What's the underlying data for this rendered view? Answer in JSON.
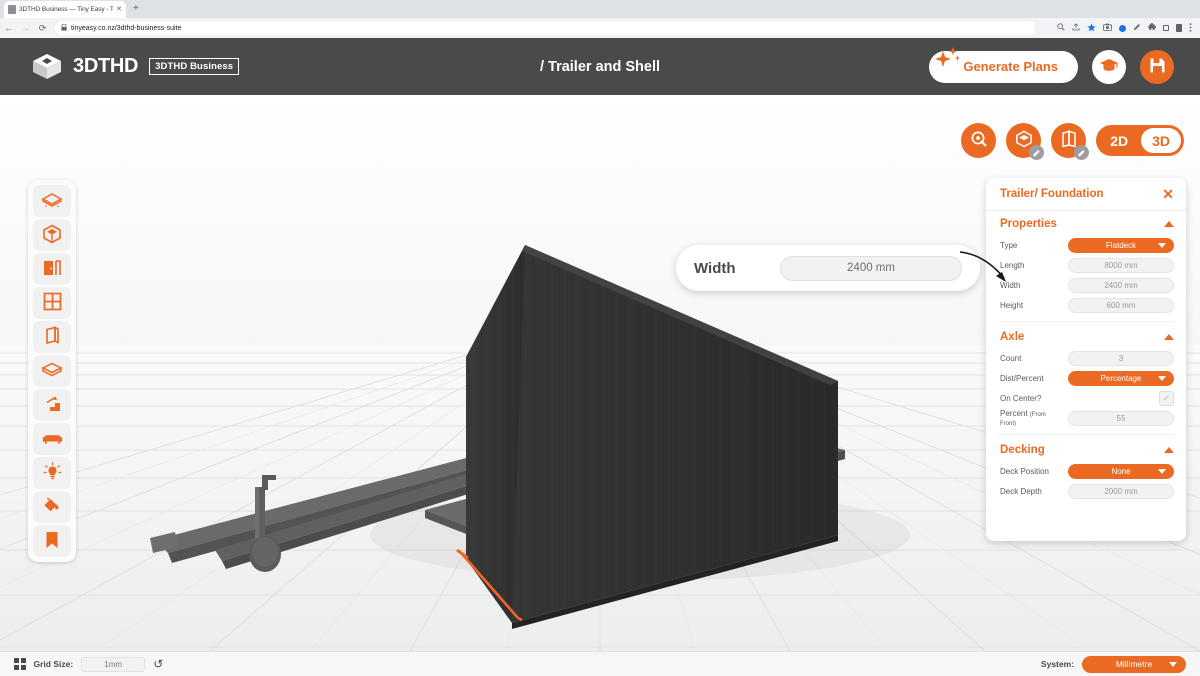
{
  "browser": {
    "tab_title": "3DTHD Business — Tiny Easy - T",
    "tab_close_glyph": "✕",
    "new_tab_glyph": "+",
    "back_glyph": "←",
    "forward_glyph": "→",
    "reload_glyph": "⟳",
    "lock_glyph": "🔒",
    "url": "tinyeasy.co.nz/3dthd-business-suite",
    "icons": [
      "zoom-icon",
      "share-icon",
      "bookmark-star-icon",
      "camera-icon",
      "status-dot-icon",
      "pencil-icon",
      "extensions-icon",
      "sidepanel-icon",
      "profile-icon",
      "menu-icon"
    ],
    "accent_blue": "#1a73e8"
  },
  "header": {
    "brand_name": "3DTHD",
    "brand_badge": "3DTHD Business",
    "title": "/ Trailer and Shell",
    "generate_label": "Generate Plans",
    "learn_icon": "graduation-cap-icon",
    "save_icon": "save-disk-icon",
    "bg_color": "#4a4a4a",
    "accent_color": "#ea6a23"
  },
  "view_controls": {
    "buttons": [
      "orbit-icon",
      "shell-view-icon",
      "open-book-view-icon"
    ],
    "dimension_options": [
      "2D",
      "3D"
    ],
    "dimension_active": "3D"
  },
  "left_toolbar": {
    "items": [
      {
        "name": "tool-trailer",
        "icon": "trailer-platform-icon"
      },
      {
        "name": "tool-shell",
        "icon": "shell-cube-icon"
      },
      {
        "name": "tool-door",
        "icon": "door-icon"
      },
      {
        "name": "tool-window",
        "icon": "window-icon"
      },
      {
        "name": "tool-wall",
        "icon": "wall-panel-icon"
      },
      {
        "name": "tool-floor",
        "icon": "floor-layers-icon"
      },
      {
        "name": "tool-stairs",
        "icon": "stairs-icon"
      },
      {
        "name": "tool-furniture",
        "icon": "sofa-icon"
      },
      {
        "name": "tool-lighting",
        "icon": "lightbulb-icon"
      },
      {
        "name": "tool-paint",
        "icon": "paint-bucket-icon"
      },
      {
        "name": "tool-bookmark",
        "icon": "bookmark-icon"
      }
    ]
  },
  "callout": {
    "label": "Width",
    "value": "2400 mm"
  },
  "panel": {
    "title": "Trailer/ Foundation",
    "close_glyph": "✕",
    "sections": [
      {
        "name": "properties",
        "title": "Properties",
        "rows": [
          {
            "label": "Type",
            "sub": "",
            "value": "Flatdeck",
            "kind": "select"
          },
          {
            "label": "Length",
            "sub": "",
            "value": "8000 mm",
            "kind": "field"
          },
          {
            "label": "Width",
            "sub": "",
            "value": "2400 mm",
            "kind": "field"
          },
          {
            "label": "Height",
            "sub": "",
            "value": "600 mm",
            "kind": "field"
          }
        ]
      },
      {
        "name": "axle",
        "title": "Axle",
        "rows": [
          {
            "label": "Count",
            "sub": "",
            "value": "3",
            "kind": "field"
          },
          {
            "label": "Dist/Percent",
            "sub": "",
            "value": "Percentage",
            "kind": "select"
          },
          {
            "label": "On Center?",
            "sub": "",
            "value": "✓",
            "kind": "checkbox"
          },
          {
            "label": "Percent",
            "sub": "(From Front)",
            "value": "55",
            "kind": "field"
          }
        ]
      },
      {
        "name": "decking",
        "title": "Decking",
        "rows": [
          {
            "label": "Deck Position",
            "sub": "",
            "value": "None",
            "kind": "select"
          },
          {
            "label": "Deck Depth",
            "sub": "",
            "value": "2000 mm",
            "kind": "field"
          }
        ]
      }
    ]
  },
  "status_bar": {
    "grid_label": "Grid Size:",
    "grid_value": "1mm",
    "reset_glyph": "↺",
    "system_label": "System:",
    "system_value": "Millimetre"
  },
  "scene": {
    "model": "tiny-house-trailer-3d-model",
    "shell_color": "#323232",
    "chassis_color": "#5c5c5c",
    "highlight_color": "#f26522",
    "floor_color": "#f2f2f2"
  }
}
